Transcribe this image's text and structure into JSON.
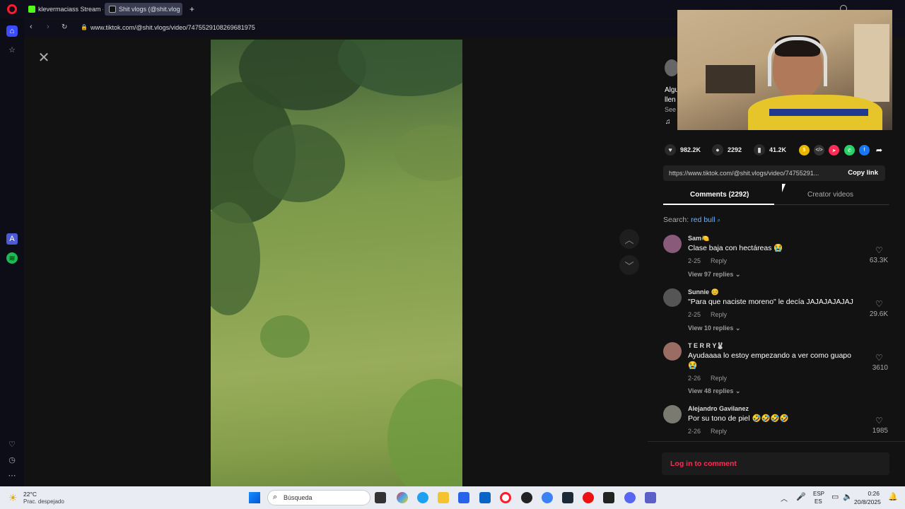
{
  "browser": {
    "tabs": [
      {
        "label": "klevermaciass Stream - W",
        "active": false
      },
      {
        "label": "Shit vlogs (@shit.vlog",
        "active": true
      }
    ],
    "new_tab_label": "+",
    "url": "www.tiktok.com/@shit.vlogs/video/7475529108269681975"
  },
  "video_panel": {
    "close_label": "✕",
    "prev_label": "︿",
    "next_label": "﹀"
  },
  "author_preview": {
    "line1": "Algu",
    "line2": "llen",
    "see_more": "See",
    "music_icon": "♫"
  },
  "actions": {
    "likes": "982.2K",
    "comments": "2292",
    "saves": "41.2K"
  },
  "share": {
    "link": "https://www.tiktok.com/@shit.vlogs/video/74755291...",
    "copy_label": "Copy link"
  },
  "tabs": {
    "comments": "Comments (2292)",
    "creator": "Creator videos"
  },
  "search": {
    "prefix": "Search:",
    "query": "red bull"
  },
  "comments": [
    {
      "user": "Sam🍋",
      "text": "Clase baja con hectáreas 😭",
      "date": "2-25",
      "reply": "Reply",
      "replies": "View 97 replies",
      "likes": "63.3K"
    },
    {
      "user": "Sunnie 😊",
      "text": "\"Para que naciste moreno\" le decía JAJAJAJAJAJ",
      "date": "2-25",
      "reply": "Reply",
      "replies": "View 10 replies",
      "likes": "29.6K"
    },
    {
      "user": "T E R R Y🐰",
      "text": "Ayudaaaa lo estoy empezando a ver como guapo 😭",
      "date": "2-26",
      "reply": "Reply",
      "replies": "View 48 replies",
      "likes": "3610"
    },
    {
      "user": "Alejandro Gavilanez",
      "text": "Por su tono de piel 🤣🤣🤣🤣",
      "date": "2-26",
      "reply": "Reply",
      "replies": "",
      "likes": "1985"
    }
  ],
  "login": "Log in to comment",
  "taskbar": {
    "weather_temp": "22°C",
    "weather_desc": "Prac. despejado",
    "search": "Búsqueda",
    "lang1": "ESP",
    "lang2": "ES",
    "time": "0:26",
    "date": "20/8/2025"
  }
}
